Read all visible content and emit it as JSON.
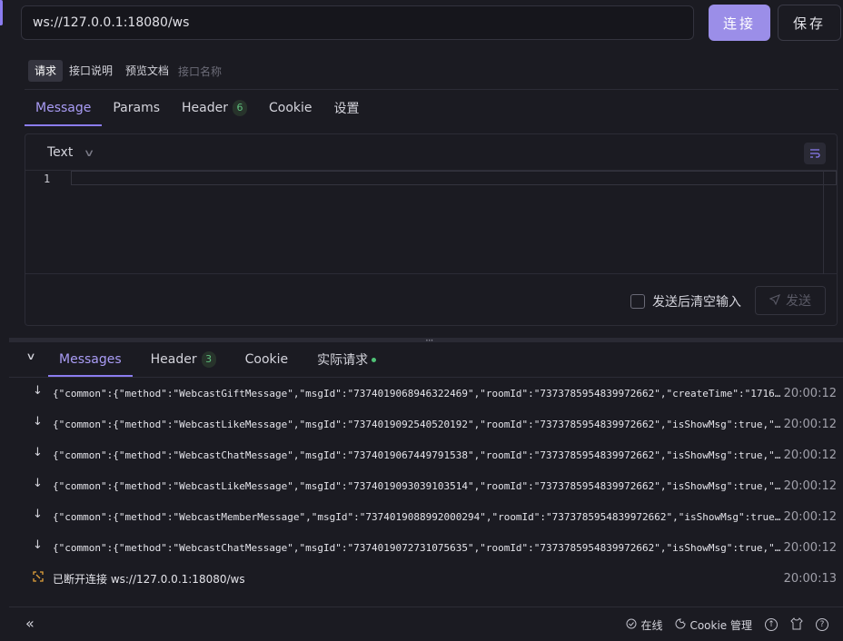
{
  "colors": {
    "accent": "#8b7cf0",
    "connect_bg": "#9b8ee8",
    "online": "#4fc276",
    "warning": "#e3a23b"
  },
  "url": {
    "value": "ws://127.0.0.1:18080/ws"
  },
  "buttons": {
    "connect": "连接",
    "save": "保存"
  },
  "meta_tabs": {
    "request": "请求",
    "api_desc": "接口说明",
    "preview_doc": "预览文档",
    "name_placeholder": "接口名称"
  },
  "request_tabs": {
    "message": "Message",
    "params": "Params",
    "header": "Header",
    "header_count": "6",
    "cookie": "Cookie",
    "settings": "设置"
  },
  "editor": {
    "format": "Text",
    "line_number": "1",
    "clear_after_send": "发送后清空输入",
    "send": "发送"
  },
  "response_tabs": {
    "messages": "Messages",
    "header": "Header",
    "header_count": "3",
    "cookie": "Cookie",
    "actual_request": "实际请求"
  },
  "messages": [
    {
      "icon": "arrow-down-icon",
      "text": "{\"common\":{\"method\":\"WebcastGiftMessage\",\"msgId\":\"7374019068946322469\",\"roomId\":\"7373785954839972662\",\"createTime\":\"1716…",
      "time": "20:00:12"
    },
    {
      "icon": "arrow-down-icon",
      "text": "{\"common\":{\"method\":\"WebcastLikeMessage\",\"msgId\":\"7374019092540520192\",\"roomId\":\"7373785954839972662\",\"isShowMsg\":true,\"…",
      "time": "20:00:12"
    },
    {
      "icon": "arrow-down-icon",
      "text": "{\"common\":{\"method\":\"WebcastChatMessage\",\"msgId\":\"7374019067449791538\",\"roomId\":\"7373785954839972662\",\"isShowMsg\":true,\"…",
      "time": "20:00:12"
    },
    {
      "icon": "arrow-down-icon",
      "text": "{\"common\":{\"method\":\"WebcastLikeMessage\",\"msgId\":\"7374019093039103514\",\"roomId\":\"7373785954839972662\",\"isShowMsg\":true,\"…",
      "time": "20:00:12"
    },
    {
      "icon": "arrow-down-icon",
      "text": "{\"common\":{\"method\":\"WebcastMemberMessage\",\"msgId\":\"7374019088992000294\",\"roomId\":\"7373785954839972662\",\"isShowMsg\":true…",
      "time": "20:00:12"
    },
    {
      "icon": "arrow-down-icon",
      "text": "{\"common\":{\"method\":\"WebcastChatMessage\",\"msgId\":\"7374019072731075635\",\"roomId\":\"7373785954839972662\",\"isShowMsg\":true,\"…",
      "time": "20:00:12"
    },
    {
      "icon": "disconnect-icon",
      "text": "已断开连接 ws://127.0.0.1:18080/ws",
      "time": "20:00:13"
    }
  ],
  "status_bar": {
    "online": "在线",
    "cookie_manage": "Cookie 管理"
  }
}
